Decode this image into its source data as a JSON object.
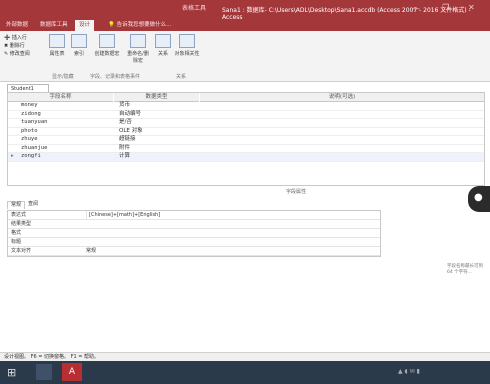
{
  "titlebar": {
    "context_tab": "表格工具",
    "title": "Sana1 : 数据库- C:\\Users\\ADL\\Desktop\\Sana1.accdb (Access 2007 - 2016 文件格式) - Access"
  },
  "ribbon_tabs": [
    "外部数据",
    "数据库工具",
    "设计",
    "告诉我您想要做什么..."
  ],
  "ribbon": {
    "small_buttons": [
      "插入行",
      "删除行",
      "修改查阅"
    ],
    "buttons": [
      "属性表",
      "索引",
      "创建数据宏",
      "重命名/删除宏",
      "关系",
      "对象相关性"
    ],
    "group_labels": [
      "显示/隐藏",
      "字段、记录和表格事件",
      "关系"
    ]
  },
  "document": {
    "tab_label": "Student1",
    "columns": [
      "字段名称",
      "数据类型",
      "说明(可选)"
    ],
    "fields": [
      {
        "name": "money",
        "type": "货币"
      },
      {
        "name": "zidong",
        "type": "自动编号"
      },
      {
        "name": "tuanyuan",
        "type": "是/否"
      },
      {
        "name": "photo",
        "type": "OLE 对象"
      },
      {
        "name": "zhuye",
        "type": "超链接"
      },
      {
        "name": "zhuanjue",
        "type": "附件"
      },
      {
        "name": "zongfi",
        "type": "计算"
      }
    ]
  },
  "properties": {
    "header": "字段属性",
    "tabs": [
      "常规",
      "查阅"
    ],
    "rows": [
      {
        "label": "表达式",
        "value": "[Chinese]+[math]+[English]"
      },
      {
        "label": "结果类型",
        "value": ""
      },
      {
        "label": "格式",
        "value": ""
      },
      {
        "label": "标题",
        "value": ""
      },
      {
        "label": "文本对齐",
        "value": "常规"
      }
    ],
    "help_text": "字段名称最长可到 64 个字符..."
  },
  "statusbar": {
    "text": "设计视图。 F6 = 切换窗格。 F1 = 帮助。"
  },
  "taskbar": {
    "items": [
      "start",
      "explorer",
      "access"
    ]
  }
}
